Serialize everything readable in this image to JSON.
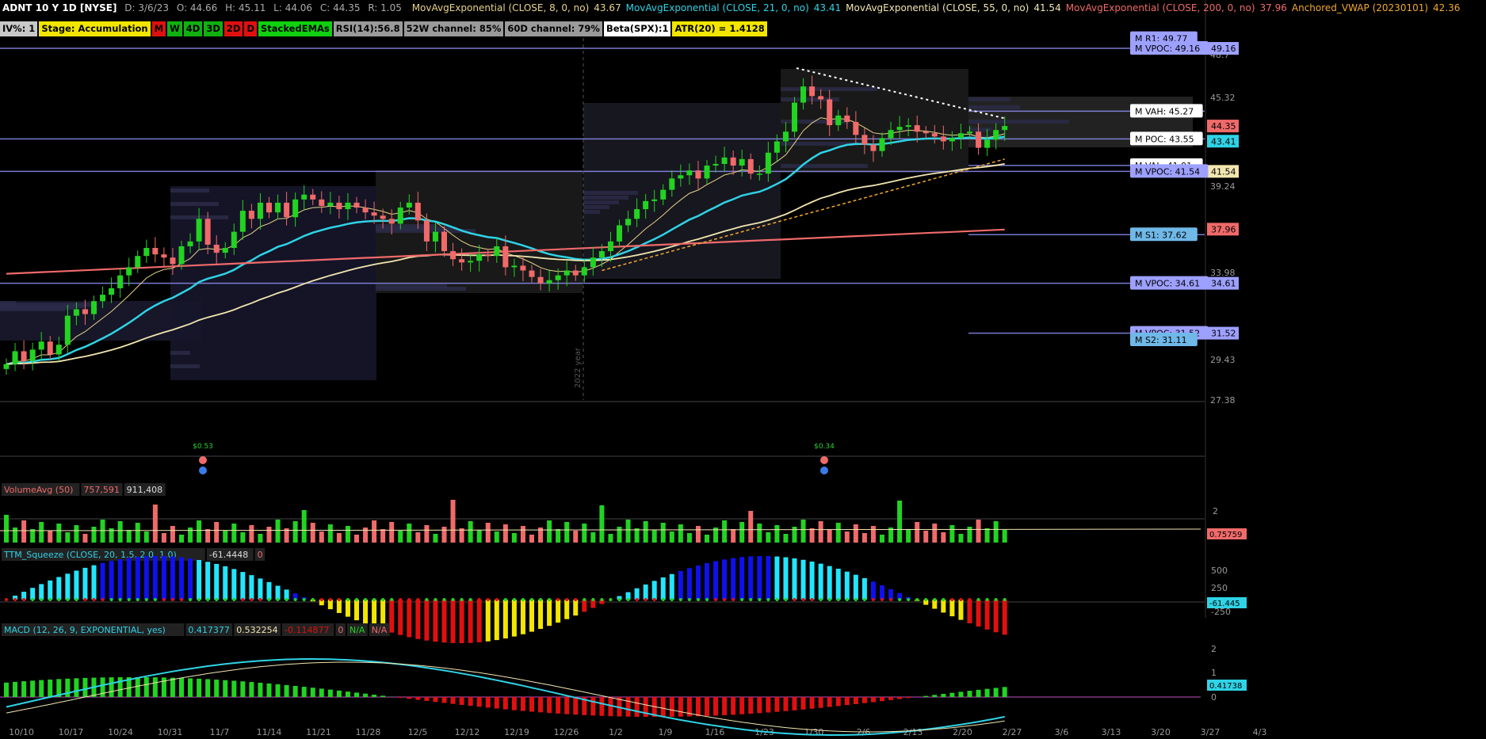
{
  "header": {
    "symbol": "ADNT 10 Y 1D [NYSE]",
    "date": "D: 3/6/23",
    "open": "O: 44.66",
    "high": "H: 45.11",
    "low": "L: 44.06",
    "close": "C: 44.35",
    "range": "R: 1.05",
    "studies": [
      {
        "label": "MovAvgExponential (CLOSE, 8, 0, no)",
        "value": "43.67",
        "color": "#e8d38a"
      },
      {
        "label": "MovAvgExponential (CLOSE, 21, 0, no)",
        "value": "43.41",
        "color": "#2fd3e6"
      },
      {
        "label": "MovAvgExponential (CLOSE, 55, 0, no)",
        "value": "41.54",
        "color": "#f2e6b0"
      },
      {
        "label": "MovAvgExponential (CLOSE, 200, 0, no)",
        "value": "37.96",
        "color": "#f06a6a"
      },
      {
        "label": "Anchored_VWAP (20230101)",
        "value": "42.36",
        "color": "#f0a830"
      }
    ]
  },
  "labels_row": [
    {
      "text": "IV%: 1",
      "bg": "#c8c8c8",
      "fg": "#000"
    },
    {
      "text": "Stage: Accumulation",
      "bg": "#f2e600",
      "fg": "#000"
    },
    {
      "text": "M",
      "bg": "#e01010",
      "fg": "#000"
    },
    {
      "text": "W",
      "bg": "#10b010",
      "fg": "#000"
    },
    {
      "text": "4D",
      "bg": "#10b010",
      "fg": "#000"
    },
    {
      "text": "3D",
      "bg": "#10b010",
      "fg": "#000"
    },
    {
      "text": "2D",
      "bg": "#e01010",
      "fg": "#000"
    },
    {
      "text": "D",
      "bg": "#e01010",
      "fg": "#000"
    },
    {
      "text": "StackedEMAs",
      "bg": "#10d010",
      "fg": "#000"
    },
    {
      "text": "RSI(14):56.8",
      "bg": "#9a9a9a",
      "fg": "#000"
    },
    {
      "text": "52W channel: 85%",
      "bg": "#9a9a9a",
      "fg": "#000"
    },
    {
      "text": "60D channel: 79%",
      "bg": "#9a9a9a",
      "fg": "#000"
    },
    {
      "text": "Beta(SPX):1",
      "bg": "#ffffff",
      "fg": "#000"
    },
    {
      "text": "ATR(20) = 1.4128",
      "bg": "#f2e600",
      "fg": "#000"
    }
  ],
  "price_axis": {
    "ticks": [
      "48.7",
      "45.32",
      "42.17",
      "39.24",
      "36.52",
      "33.98",
      "29.43",
      "27.38"
    ],
    "badges": [
      {
        "text": "49.16",
        "value": 49.16,
        "color": "#9da0ff"
      },
      {
        "text": "44.35",
        "value": 44.35,
        "color": "#f06a6a"
      },
      {
        "text": "43.41",
        "value": 43.41,
        "color": "#2fd3e6"
      },
      {
        "text": "41.54",
        "value": 41.54,
        "color": "#f2e6b0"
      },
      {
        "text": "37.96",
        "value": 37.96,
        "color": "#f06a6a"
      },
      {
        "text": "34.61",
        "value": 34.61,
        "color": "#9da0ff"
      },
      {
        "text": "31.52",
        "value": 31.52,
        "color": "#9da0ff"
      }
    ]
  },
  "level_labels": [
    {
      "text": "M R1: 49.77",
      "value": 49.77,
      "style": "blue"
    },
    {
      "text": "M VPOC: 49.16",
      "value": 49.16,
      "style": "blue"
    },
    {
      "text": "M VAH: 45.27",
      "value": 45.27,
      "style": "white"
    },
    {
      "text": "M POC: 43.55",
      "value": 43.55,
      "style": "white"
    },
    {
      "text": "M VAL: 41.91",
      "value": 41.91,
      "style": "white"
    },
    {
      "text": "M VPOC: 41.54",
      "value": 41.54,
      "style": "blue"
    },
    {
      "text": "M S1: 37.62",
      "value": 37.62,
      "style": "cyan"
    },
    {
      "text": "M VPOC: 34.61",
      "value": 34.61,
      "style": "blue"
    },
    {
      "text": "M VPOC: 31.52",
      "value": 31.52,
      "style": "blue"
    },
    {
      "text": "M S2: 31.11",
      "value": 31.11,
      "style": "cyan"
    }
  ],
  "dividends": [
    "$0.53",
    "$0.34"
  ],
  "year_label": "2022 year",
  "volume_panel": {
    "title": "VolumeAvg (50)",
    "v1": "757,591",
    "v2": "911,408",
    "ticks": [
      "2"
    ],
    "badge": "0.75759"
  },
  "squeeze_panel": {
    "title": "TTM_Squeeze (CLOSE, 20, 1.5, 2.0, 1.0)",
    "v1": "-61.4448",
    "v2": "0",
    "ticks": [
      "500",
      "250",
      "-250"
    ],
    "badge": "-61.445"
  },
  "macd_panel": {
    "title": "MACD (12, 26, 9, EXPONENTIAL, yes)",
    "v1": "0.417377",
    "v2": "0.532254",
    "v3": "-0.114877",
    "v4": "0",
    "v5": "N/A",
    "v6": "N/A",
    "ticks": [
      "2",
      "1",
      "0"
    ],
    "badge": "0.41738"
  },
  "chart_data": {
    "type": "candlestick",
    "x_ticks": [
      "10/10",
      "10/17",
      "10/24",
      "10/31",
      "11/7",
      "11/14",
      "11/21",
      "11/28",
      "12/5",
      "12/12",
      "12/19",
      "12/26",
      "1/2",
      "1/9",
      "1/16",
      "1/23",
      "1/30",
      "2/6",
      "2/13",
      "2/20",
      "2/27",
      "3/6",
      "3/13",
      "3/20",
      "3/27",
      "4/3"
    ],
    "closes": [
      29.6,
      30.4,
      29.8,
      30.5,
      31.0,
      30.2,
      30.8,
      32.6,
      33.0,
      32.7,
      33.5,
      33.9,
      34.3,
      35.1,
      35.6,
      36.3,
      36.8,
      36.4,
      36.2,
      35.8,
      36.9,
      37.2,
      38.6,
      37.0,
      36.5,
      36.8,
      37.8,
      39.1,
      38.6,
      39.6,
      39.0,
      39.6,
      38.7,
      39.8,
      40.1,
      39.8,
      39.4,
      39.6,
      39.2,
      39.6,
      39.3,
      39.0,
      38.8,
      38.6,
      38.3,
      39.3,
      39.6,
      38.5,
      37.2,
      37.8,
      36.6,
      36.1,
      35.9,
      36.0,
      36.4,
      36.3,
      36.9,
      35.6,
      35.7,
      35.4,
      35.0,
      34.6,
      34.8,
      35.1,
      35.4,
      35.1,
      35.6,
      36.2,
      36.6,
      37.2,
      38.2,
      38.6,
      39.2,
      39.7,
      39.8,
      40.4,
      41.1,
      41.3,
      41.6,
      41.1,
      41.9,
      42.0,
      42.4,
      41.9,
      42.3,
      41.4,
      41.4,
      42.7,
      43.4,
      44.0,
      45.8,
      46.8,
      46.2,
      46.0,
      44.4,
      45.0,
      44.6,
      43.8,
      43.2,
      42.8,
      43.6,
      44.1,
      44.3,
      44.4,
      44.0,
      43.9,
      43.7,
      43.4,
      43.6,
      43.9,
      44.0,
      43.0,
      43.5,
      44.1,
      44.35
    ],
    "series": [
      {
        "name": "MovAvgExponential (CLOSE, 8, 0, no)",
        "last": 43.67
      },
      {
        "name": "MovAvgExponential (CLOSE, 21, 0, no)",
        "last": 43.41
      },
      {
        "name": "MovAvgExponential (CLOSE, 55, 0, no)",
        "last": 41.54
      },
      {
        "name": "MovAvgExponential (CLOSE, 200, 0, no)",
        "last": 37.96
      },
      {
        "name": "Anchored_VWAP (20230101)",
        "last": 42.36
      }
    ],
    "levels": [
      49.16,
      45.27,
      43.55,
      41.91,
      41.54,
      37.62,
      34.61,
      31.52
    ],
    "ylim": [
      27.38,
      49.8
    ]
  },
  "colors": {
    "up": "#22d322",
    "down": "#f06a6a",
    "grid": "#222",
    "level": "#8f8ff5",
    "panel_border": "#444"
  }
}
